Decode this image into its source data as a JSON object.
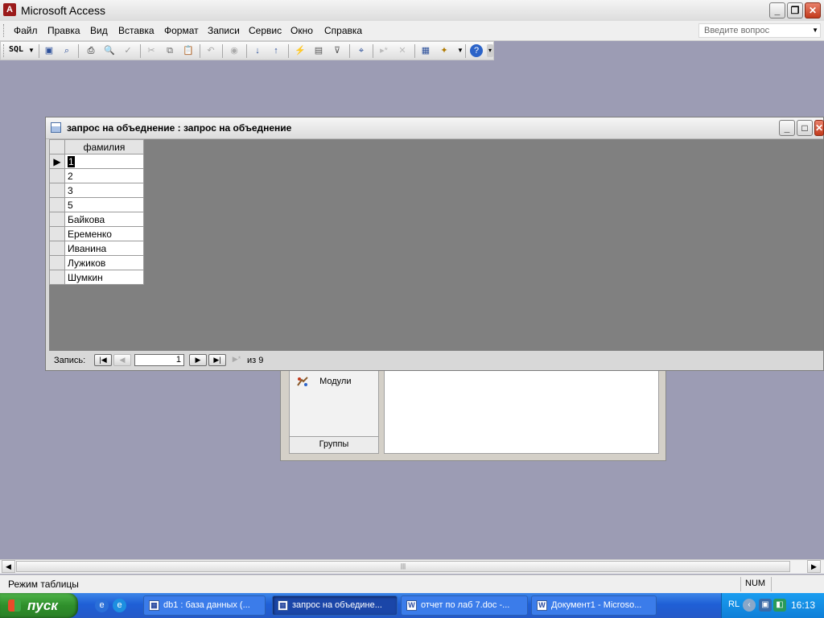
{
  "app": {
    "title": "Microsoft Access"
  },
  "menu": {
    "items": [
      "Файл",
      "Правка",
      "Вид",
      "Вставка",
      "Формат",
      "Записи",
      "Сервис",
      "Окно",
      "Справка"
    ],
    "ask_placeholder": "Введите вопрос"
  },
  "toolbar": {
    "sql_label": "SQL"
  },
  "query_window": {
    "title": "запрос на объеднение : запрос на объеднение",
    "column_header": "фамилия",
    "rows": [
      "1",
      "2",
      "3",
      "5",
      "Байкова",
      "Еременко",
      "Иванина",
      "Лужиков",
      "Шумкин"
    ],
    "nav": {
      "record_label": "Запись:",
      "current": "1",
      "of_label": "из 9"
    }
  },
  "db_window": {
    "modules_label": "Модули",
    "groups_label": "Группы"
  },
  "statusbar": {
    "mode": "Режим таблицы",
    "num": "NUM"
  },
  "taskbar": {
    "start_label": "пуск",
    "tasks": [
      "db1 : база данных (...",
      "запрос на объедине...",
      "отчет по лаб 7.doc -...",
      "Документ1 - Microso..."
    ],
    "lang": "RL",
    "clock": "16:13"
  },
  "colors": {
    "workspace": "#9c9cb4",
    "taskbar": "#245edb",
    "start": "#3a9a35"
  }
}
